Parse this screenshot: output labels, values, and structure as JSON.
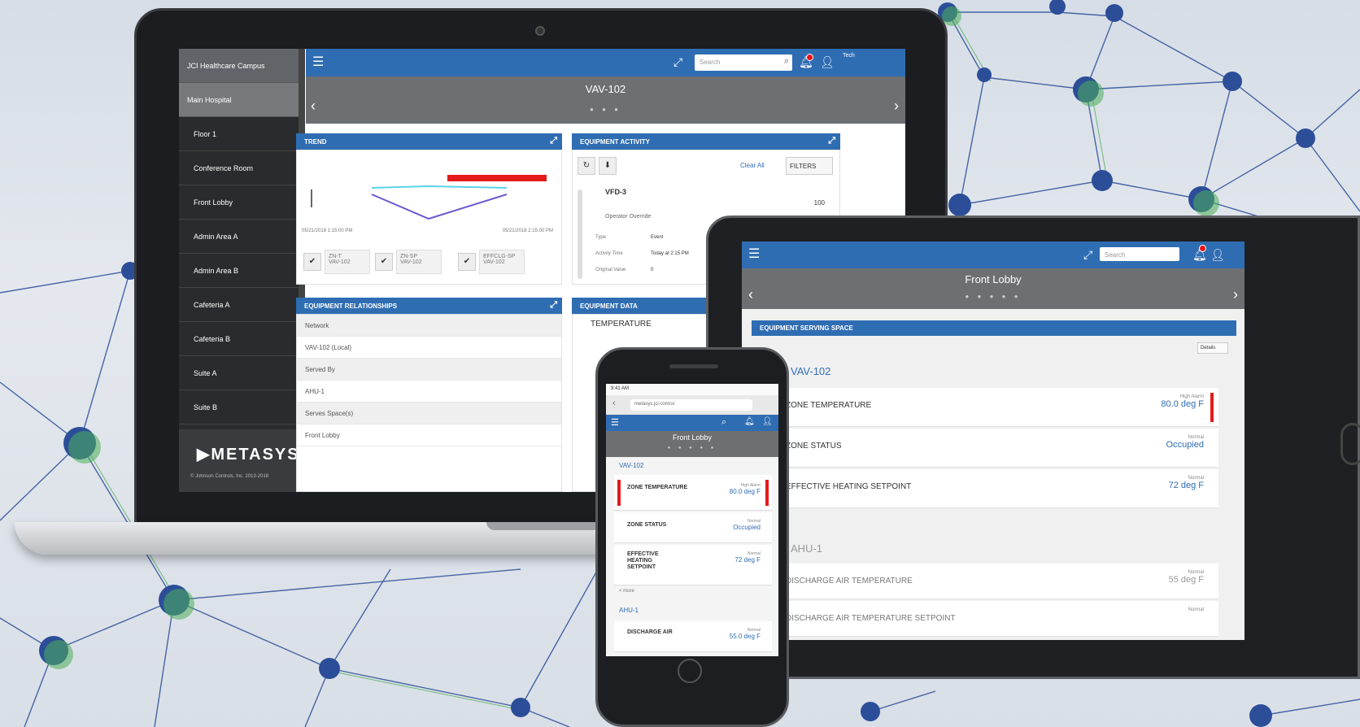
{
  "brand": {
    "logo": "METASYS",
    "copyright": "© Johnson Controls, Inc. 2013-2018"
  },
  "laptop": {
    "sidebar": {
      "sites": [
        "JCI Healthcare Campus",
        "Main Hospital"
      ],
      "items": [
        "Floor 1",
        "Conference Room",
        "Front Lobby",
        "Admin Area A",
        "Admin Area B",
        "Cafeteria A",
        "Cafeteria B",
        "Suite A",
        "Suite B"
      ]
    },
    "topbar": {
      "search_placeholder": "Search",
      "user": "Tech"
    },
    "header": {
      "title": "VAV-102"
    },
    "trend": {
      "title": "TREND",
      "start": "05/21/2018 1:15:00 PM",
      "end": "05/21/2018 2:15:00 PM",
      "checks": [
        {
          "name": "ZN-T",
          "sub": "VAV-102"
        },
        {
          "name": "ZN-SP",
          "sub": "VAV-102"
        },
        {
          "name": "EFFCLG-SP",
          "sub": "VAV-102"
        }
      ]
    },
    "activity": {
      "title": "EQUIPMENT ACTIVITY",
      "clear": "Clear All",
      "filters": "FILTERS",
      "item_title": "VFD-3",
      "item_status": "Operator Override",
      "labels": [
        "Type",
        "Activity Time",
        "Original Value"
      ],
      "values": [
        "Event",
        "Today at 2:15 PM",
        "0"
      ],
      "count": "100"
    },
    "relationships": {
      "title": "EQUIPMENT RELATIONSHIPS",
      "rows": [
        "Network",
        "VAV-102 (Local)",
        "Served By",
        "AHU-1",
        "Serves Space(s)",
        "Front Lobby"
      ]
    },
    "data": {
      "title": "EQUIPMENT DATA",
      "first": "TEMPERATURE"
    }
  },
  "tablet": {
    "header": {
      "title": "Front Lobby"
    },
    "panel": {
      "title": "EQUIPMENT SERVING SPACE",
      "details": "Details"
    },
    "section1": "VAV-102",
    "section2": "AHU-1",
    "rows": [
      {
        "label": "ZONE TEMPERATURE",
        "status": "High Alarm",
        "value": "80.0 deg F"
      },
      {
        "label": "ZONE STATUS",
        "status": "Normal",
        "value": "Occupied"
      },
      {
        "label": "EFFECTIVE HEATING SETPOINT",
        "status": "Normal",
        "value": "72 deg F"
      },
      {
        "label": "DISCHARGE AIR TEMPERATURE",
        "status": "Normal",
        "value": "55 deg F"
      },
      {
        "label": "DISCHARGE AIR TEMPERATURE SETPOINT",
        "status": "Normal",
        "value": ""
      }
    ]
  },
  "phone": {
    "status_time": "9:41 AM",
    "url": "metasys.jci.com/ui",
    "header": {
      "title": "Front Lobby"
    },
    "section1": "VAV-102",
    "section2": "AHU-1",
    "more": "< more",
    "rows": [
      {
        "label": "ZONE TEMPERATURE",
        "status": "High Alarm",
        "value": "80.0 deg F"
      },
      {
        "label": "ZONE STATUS",
        "status": "Normal",
        "value": "Occupied"
      },
      {
        "label": "EFFECTIVE HEATING SETPOINT",
        "status": "Normal",
        "value": "72 deg F"
      },
      {
        "label": "DISCHARGE AIR",
        "status": "Normal",
        "value": "55.0 deg F"
      }
    ]
  },
  "colors": {
    "accent": "#2f6db3",
    "alarm": "#e31b1b",
    "node": "#2c4e99",
    "node_glow": "#4caf5a"
  }
}
